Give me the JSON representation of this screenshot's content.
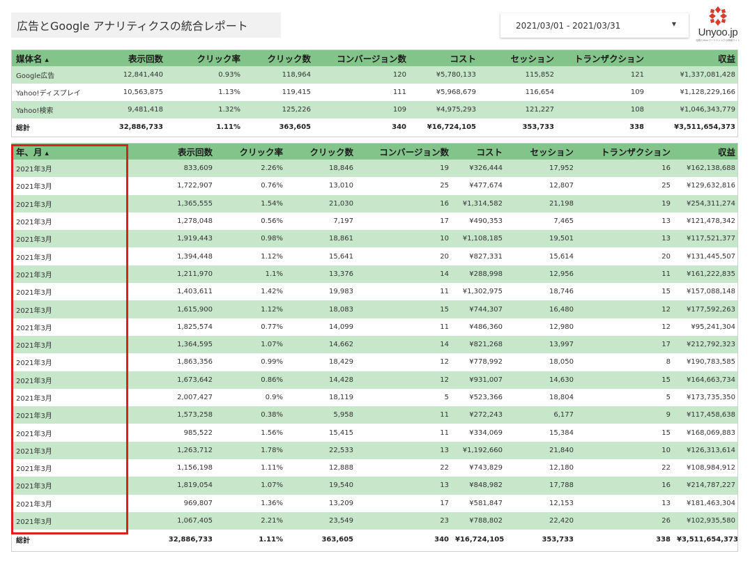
{
  "report": {
    "title": "広告とGoogle アナリティクスの統合レポート",
    "date_range": "2021/03/01 - 2021/03/31",
    "logo": {
      "name": "Unyoo.jp",
      "tagline": "話題のWebマーケティングの情報サイト"
    }
  },
  "colors": {
    "header_green": "#83c48a",
    "row_green": "#c6e7c9",
    "highlight_red": "#dd1f1f",
    "logo_red": "#d93b2b"
  },
  "icons": {
    "sort": "sort-ascending-icon",
    "dropdown": "caret-down-icon",
    "logo": "unyoo-logo-icon"
  },
  "table_media": {
    "headers": [
      "媒体名",
      "表示回数",
      "クリック率",
      "クリック数",
      "コンバージョン数",
      "コスト",
      "セッション",
      "トランザクション",
      "収益"
    ],
    "sort_indicator": "▲",
    "rows": [
      [
        "Google広告",
        "12,841,440",
        "0.93%",
        "118,964",
        "120",
        "¥5,780,133",
        "115,852",
        "121",
        "¥1,337,081,428"
      ],
      [
        "Yahoo!ディスプレイ",
        "10,563,875",
        "1.13%",
        "119,415",
        "111",
        "¥5,968,679",
        "116,654",
        "109",
        "¥1,128,229,166"
      ],
      [
        "Yahoo!検索",
        "9,481,418",
        "1.32%",
        "125,226",
        "109",
        "¥4,975,293",
        "121,227",
        "108",
        "¥1,046,343,779"
      ]
    ],
    "total": [
      "総計",
      "32,886,733",
      "1.11%",
      "363,605",
      "340",
      "¥16,724,105",
      "353,733",
      "338",
      "¥3,511,654,373"
    ]
  },
  "table_month": {
    "headers": [
      "年、月",
      "表示回数",
      "クリック率",
      "クリック数",
      "コンバージョン数",
      "コスト",
      "セッション",
      "トランザクション",
      "収益"
    ],
    "sort_indicator": "▲",
    "rows": [
      [
        "2021年3月",
        "833,609",
        "2.26%",
        "18,846",
        "19",
        "¥326,444",
        "17,952",
        "16",
        "¥162,138,688"
      ],
      [
        "2021年3月",
        "1,722,907",
        "0.76%",
        "13,010",
        "25",
        "¥477,674",
        "12,807",
        "25",
        "¥129,632,816"
      ],
      [
        "2021年3月",
        "1,365,555",
        "1.54%",
        "21,030",
        "16",
        "¥1,314,582",
        "21,198",
        "19",
        "¥254,311,274"
      ],
      [
        "2021年3月",
        "1,278,048",
        "0.56%",
        "7,197",
        "17",
        "¥490,353",
        "7,465",
        "13",
        "¥121,478,342"
      ],
      [
        "2021年3月",
        "1,919,443",
        "0.98%",
        "18,861",
        "10",
        "¥1,108,185",
        "19,501",
        "13",
        "¥117,521,377"
      ],
      [
        "2021年3月",
        "1,394,448",
        "1.12%",
        "15,641",
        "20",
        "¥827,331",
        "15,614",
        "20",
        "¥131,445,507"
      ],
      [
        "2021年3月",
        "1,211,970",
        "1.1%",
        "13,376",
        "14",
        "¥288,998",
        "12,956",
        "11",
        "¥161,222,835"
      ],
      [
        "2021年3月",
        "1,403,611",
        "1.42%",
        "19,983",
        "11",
        "¥1,302,975",
        "18,746",
        "15",
        "¥157,088,148"
      ],
      [
        "2021年3月",
        "1,615,900",
        "1.12%",
        "18,083",
        "15",
        "¥744,307",
        "16,480",
        "12",
        "¥177,592,263"
      ],
      [
        "2021年3月",
        "1,825,574",
        "0.77%",
        "14,099",
        "11",
        "¥486,360",
        "12,980",
        "12",
        "¥95,241,304"
      ],
      [
        "2021年3月",
        "1,364,595",
        "1.07%",
        "14,662",
        "14",
        "¥821,268",
        "13,997",
        "17",
        "¥212,792,323"
      ],
      [
        "2021年3月",
        "1,863,356",
        "0.99%",
        "18,429",
        "12",
        "¥778,992",
        "18,050",
        "8",
        "¥190,783,585"
      ],
      [
        "2021年3月",
        "1,673,642",
        "0.86%",
        "14,428",
        "12",
        "¥931,007",
        "14,630",
        "15",
        "¥164,663,734"
      ],
      [
        "2021年3月",
        "2,007,427",
        "0.9%",
        "18,119",
        "5",
        "¥523,366",
        "18,804",
        "5",
        "¥173,735,350"
      ],
      [
        "2021年3月",
        "1,573,258",
        "0.38%",
        "5,958",
        "11",
        "¥272,243",
        "6,177",
        "9",
        "¥117,458,638"
      ],
      [
        "2021年3月",
        "985,522",
        "1.56%",
        "15,415",
        "11",
        "¥334,069",
        "15,384",
        "15",
        "¥168,069,883"
      ],
      [
        "2021年3月",
        "1,263,712",
        "1.78%",
        "22,533",
        "13",
        "¥1,192,660",
        "21,840",
        "10",
        "¥126,313,614"
      ],
      [
        "2021年3月",
        "1,156,198",
        "1.11%",
        "12,888",
        "22",
        "¥743,829",
        "12,180",
        "22",
        "¥108,984,912"
      ],
      [
        "2021年3月",
        "1,819,054",
        "1.07%",
        "19,540",
        "13",
        "¥848,982",
        "17,788",
        "16",
        "¥214,787,227"
      ],
      [
        "2021年3月",
        "969,807",
        "1.36%",
        "13,209",
        "17",
        "¥581,847",
        "12,153",
        "13",
        "¥181,463,304"
      ],
      [
        "2021年3月",
        "1,067,405",
        "2.21%",
        "23,549",
        "23",
        "¥788,802",
        "22,420",
        "26",
        "¥102,935,580"
      ]
    ],
    "total": [
      "総計",
      "32,886,733",
      "1.11%",
      "363,605",
      "340",
      "¥16,724,105",
      "353,733",
      "338",
      "¥3,511,654,373"
    ]
  }
}
